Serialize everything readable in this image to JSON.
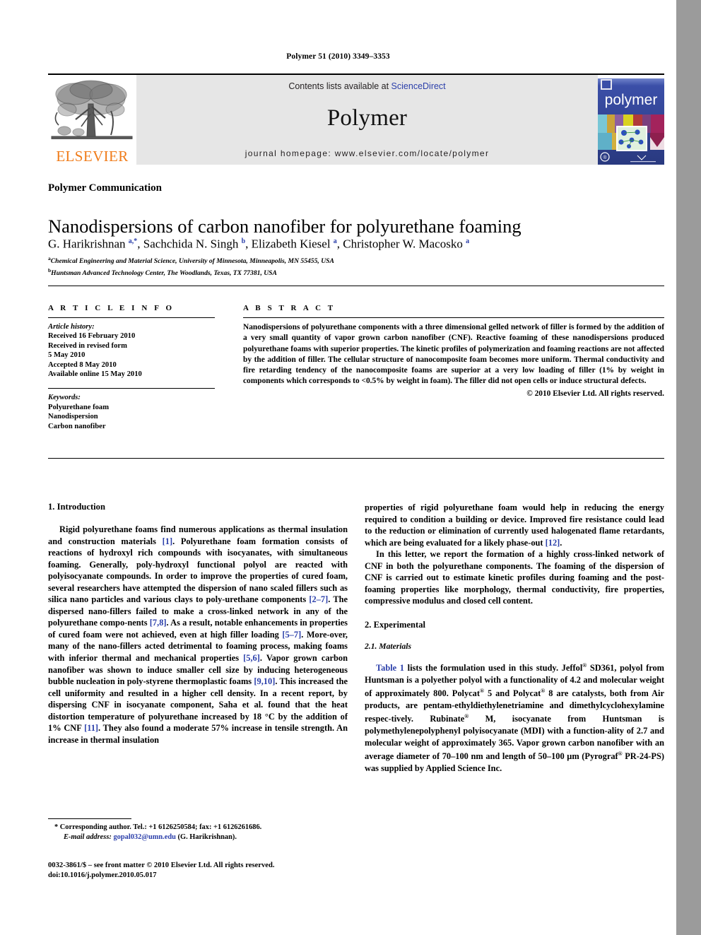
{
  "running_head": "Polymer 51 (2010) 3349–3353",
  "masthead": {
    "publisher_name": "ELSEVIER",
    "contents_prefix": "Contents lists available at ",
    "contents_link": "ScienceDirect",
    "journal_name": "Polymer",
    "homepage_line": "journal homepage: www.elsevier.com/locate/polymer",
    "cover_title": "polymer"
  },
  "article": {
    "kicker": "Polymer Communication",
    "title": "Nanodispersions of carbon nanofiber for polyurethane foaming",
    "authors_html": "G. Harikrishnan <sup>a,*</sup>, Sachchida N. Singh <sup>b</sup>, Elizabeth Kiesel <sup>a</sup>, Christopher W. Macosko <sup>a</sup>",
    "affiliation_a": "Chemical Engineering and Material Science, University of Minnesota, Minneapolis, MN 55455, USA",
    "affiliation_b": "Huntsman Advanced Technology Center, The Woodlands, Texas, TX 77381, USA"
  },
  "info": {
    "header": "A R T I C L E   I N F O",
    "history_label": "Article history:",
    "history": [
      "Received 16 February 2010",
      "Received in revised form",
      "5 May 2010",
      "Accepted 8 May 2010",
      "Available online 15 May 2010"
    ],
    "keywords_label": "Keywords:",
    "keywords": [
      "Polyurethane foam",
      "Nanodispersion",
      "Carbon nanofiber"
    ]
  },
  "abstract": {
    "header": "A B S T R A C T",
    "text": "Nanodispersions of polyurethane components with a three dimensional gelled network of filler is formed by the addition of a very small quantity of vapor grown carbon nanofiber (CNF). Reactive foaming of these nanodispersions produced polyurethane foams with superior properties. The kinetic profiles of polymerization and foaming reactions are not affected by the addition of filler. The cellular structure of nanocomposite foam becomes more uniform. Thermal conductivity and fire retarding tendency of the nanocomposite foams are superior at a very low loading of filler (1% by weight in components which corresponds to <0.5% by weight in foam). The filler did not open cells or induce structural defects.",
    "copyright": "© 2010 Elsevier Ltd. All rights reserved."
  },
  "body": {
    "intro_heading": "1. Introduction",
    "intro_p1_html": "Rigid polyurethane foams find numerous applications as thermal insulation and construction materials <span class=\"ref\">[1]</span>. Polyurethane foam formation consists of reactions of hydroxyl rich compounds with isocyanates, with simultaneous foaming. Generally, poly-hydroxyl functional polyol are reacted with polyisocyanate compounds. In order to improve the properties of cured foam, several researchers have attempted the dispersion of nano scaled fillers such as silica nano particles and various clays to poly-urethane components <span class=\"ref\">[2–7]</span>. The dispersed nano-fillers failed to make a cross-linked network in any of the polyurethane compo-nents <span class=\"ref\">[7,8]</span>. As a result, notable enhancements in properties of cured foam were not achieved, even at high filler loading <span class=\"ref\">[5–7]</span>. More-over, many of the nano-fillers acted detrimental to foaming process, making foams with inferior thermal and mechanical properties <span class=\"ref\">[5,6]</span>. Vapor grown carbon nanofiber was shown to induce smaller cell size by inducing heterogeneous bubble nucleation in poly-styrene thermoplastic foams <span class=\"ref\">[9,10]</span>. This increased the cell uniformity and resulted in a higher cell density. In a recent report, by dispersing CNF in isocyanate component, Saha et al. found that the heat distortion temperature of polyurethane increased by 18 °C by the addition of 1% CNF <span class=\"ref\">[11]</span>. They also found a moderate 57% increase in tensile strength. An increase in thermal insulation",
    "right_p1_html": "properties of rigid polyurethane foam would help in reducing the energy required to condition a building or device. Improved fire resistance could lead to the reduction or elimination of currently used halogenated flame retardants, which are being evaluated for a likely phase-out <span class=\"ref\">[12]</span>.",
    "right_p2_html": "In this letter, we report the formation of a highly cross-linked network of CNF in both the polyurethane components. The foaming of the dispersion of CNF is carried out to estimate kinetic profiles during foaming and the post-foaming properties like morphology, thermal conductivity, fire properties, compressive modulus and closed cell content.",
    "experimental_heading": "2. Experimental",
    "materials_heading": "2.1. Materials",
    "materials_p_html": "<span class=\"lnk\">Table 1</span> lists the formulation used in this study. Jeffol<sup class=\"reg\">®</sup> SD361, polyol from Huntsman is a polyether polyol with a functionality of 4.2 and molecular weight of approximately 800. Polycat<sup class=\"reg\">®</sup> 5 and Polycat<sup class=\"reg\">®</sup> 8 are catalysts, both from Air products, are pentam-ethyldiethylenetriamine and dimethylcyclohexylamine respec-tively. Rubinate<sup class=\"reg\">®</sup> M, isocyanate from Huntsman is polymethylenepolyphenyl polyisocyanate (MDI) with a function-ality of 2.7 and molecular weight of approximately 365. Vapor grown carbon nanofiber with an average diameter of 70–100 nm and length of 50–100 μm (Pyrograf<sup class=\"reg\">®</sup> PR-24-PS) was supplied by Applied Science Inc."
  },
  "footnote": {
    "corresponding_html": "* Corresponding author. Tel.: +1 6126250584; fax: +1 6126261686.",
    "email_html": "<span class=\"it\">E-mail address:</span> <span class=\"lnk\">gopal032@umn.edu</span> (G. Harikrishnan).",
    "imprint_line1": "0032-3861/$ – see front matter © 2010 Elsevier Ltd. All rights reserved.",
    "imprint_line2": "doi:10.1016/j.polymer.2010.05.017"
  },
  "colors": {
    "link": "#2b3faa",
    "elsevier_orange": "#f07c1a",
    "masthead_bg": "#e6e6e6",
    "margin_gray": "#9b9b9b"
  }
}
